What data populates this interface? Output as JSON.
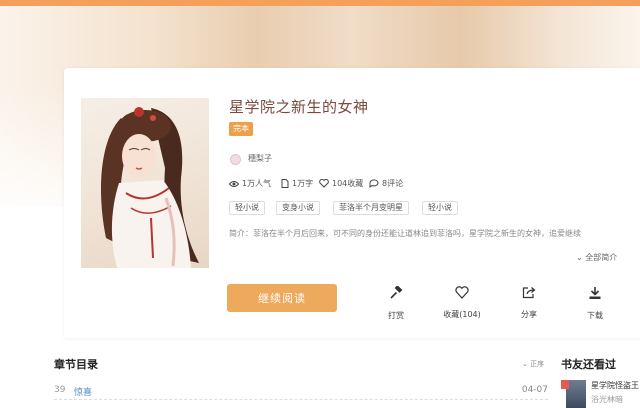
{
  "book": {
    "title": "星学院之新生的女神",
    "status": "完本",
    "author": "穗梨子",
    "popularity": "1万人气",
    "word_count": "1万字",
    "favorites": "104收藏",
    "comments": "8评论",
    "tags": [
      "轻小说",
      "变身小说",
      "菲洛半个月变明星",
      "轻小说"
    ],
    "intro": "简介：菲洛在半个月后回来，可不同的身份还能让道林追到菲洛吗，星学院之新生的女神，追爱继续",
    "expand_label": "全部简介"
  },
  "actions": {
    "read_label": "继续阅读",
    "tip_label": "打赏",
    "collect_label": "收藏(104)",
    "share_label": "分享",
    "download_label": "下载"
  },
  "chapters": {
    "title": "章节目录",
    "sort_label": "正序",
    "items": [
      {
        "num": "39",
        "title": "惊喜",
        "date": "04-07"
      }
    ]
  },
  "friends": {
    "title": "书友还看过",
    "items": [
      {
        "title": "星学院怪盗王",
        "author": "浴光林暗"
      }
    ]
  },
  "colors": {
    "accent": "#eda95c",
    "title": "#7a4a3c",
    "link": "#4b8ec9",
    "topbar": "#f5a05a"
  },
  "icons": [
    "eye-icon",
    "document-icon",
    "heart-icon",
    "chat-icon",
    "hammer-icon",
    "share-icon",
    "download-icon",
    "chevron-down-icon"
  ]
}
